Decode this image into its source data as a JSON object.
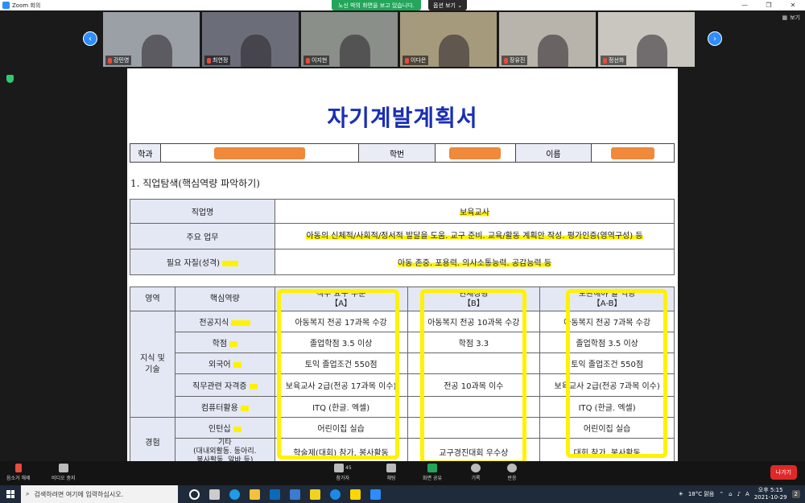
{
  "window": {
    "title": "Zoom 회의",
    "share_notice": "노신 박의 화면을 보고 있습니다.",
    "view_options": "옵션 보기 ⌄",
    "view_label": "보기"
  },
  "participants": [
    {
      "name": "강민영",
      "color": "#9aa0a6"
    },
    {
      "name": "최연정",
      "color": "#6b6e78"
    },
    {
      "name": "이지현",
      "color": "#8a8f8a"
    },
    {
      "name": "이다은",
      "color": "#a59a7c"
    },
    {
      "name": "장유진",
      "color": "#b8b4ab"
    },
    {
      "name": "정선화",
      "color": "#c9c6c0"
    }
  ],
  "document": {
    "title": "자기계발계획서",
    "info": {
      "dept_label": "학과",
      "id_label": "학번",
      "name_label": "이름"
    },
    "section1": "1. 직업탐색(핵심역량 파악하기)",
    "job_table": [
      {
        "label": "직업명",
        "value": "보육교사"
      },
      {
        "label": "주요 업무",
        "value": "아동의 신체적/사회적/정서적 발달을 도움. 교구 준비. 교육/활동 계획안 작성. 평가인증(영역구성) 등"
      },
      {
        "label": "필요 자질(성격)",
        "value": "아동 존중. 포용력. 의사소통능력. 공감능력 등"
      }
    ],
    "comp_table": {
      "headers": [
        "영역",
        "핵심역량",
        "직무 요구 수준\n【A】",
        "현재상황\n【B】",
        "보완해야 할 역량\n【A-B】"
      ],
      "group1": "지식 및\n기술",
      "group2": "경험",
      "rows": [
        {
          "competency": "전공지식",
          "a": "아동복지 전공 17과목 수강",
          "b": "아동복지 전공 10과목 수강",
          "ab": "아동복지 전공 7과목 수강"
        },
        {
          "competency": "학점",
          "a": "졸업학점 3.5 이상",
          "b": "학점 3.3",
          "ab": "졸업학점 3.5 이상"
        },
        {
          "competency": "외국어",
          "a": "토익 졸업조건 550점",
          "b": "",
          "ab": "토익 졸업조건 550점"
        },
        {
          "competency": "직무관련 자격증",
          "a": "보육교사 2급(전공 17과목 이수)",
          "b": "전공 10과목 이수",
          "ab": "보육교사 2급(전공 7과목 이수)"
        },
        {
          "competency": "컴퓨터활용",
          "a": "ITQ (한글. 엑셀)",
          "b": "",
          "ab": "ITQ (한글. 엑셀)"
        },
        {
          "competency": "인턴십",
          "a": "어린이집 실습",
          "b": "",
          "ab": "어린이집 실습"
        },
        {
          "competency": "기타\n(대내외활동. 동아리.\n봉사활동. 알바 등)",
          "a": "학술제(대회) 참가. 봉사활동",
          "b": "교구경진대회 우수상",
          "ab": "대회 참가. 봉사활동"
        }
      ]
    }
  },
  "toolbar": {
    "mute": "음소거 해제",
    "video": "비디오 중지",
    "participants": "참가자",
    "participant_count": "45",
    "chat": "채팅",
    "share": "화면 공유",
    "record": "기록",
    "reactions": "반응",
    "leave": "나가기"
  },
  "taskbar": {
    "search_placeholder": "검색하려면 여기에 입력하십시오.",
    "weather": "18°C 맑음",
    "ime": "A",
    "time": "오후 5:15",
    "date": "2021-10-29",
    "notif": "2"
  }
}
